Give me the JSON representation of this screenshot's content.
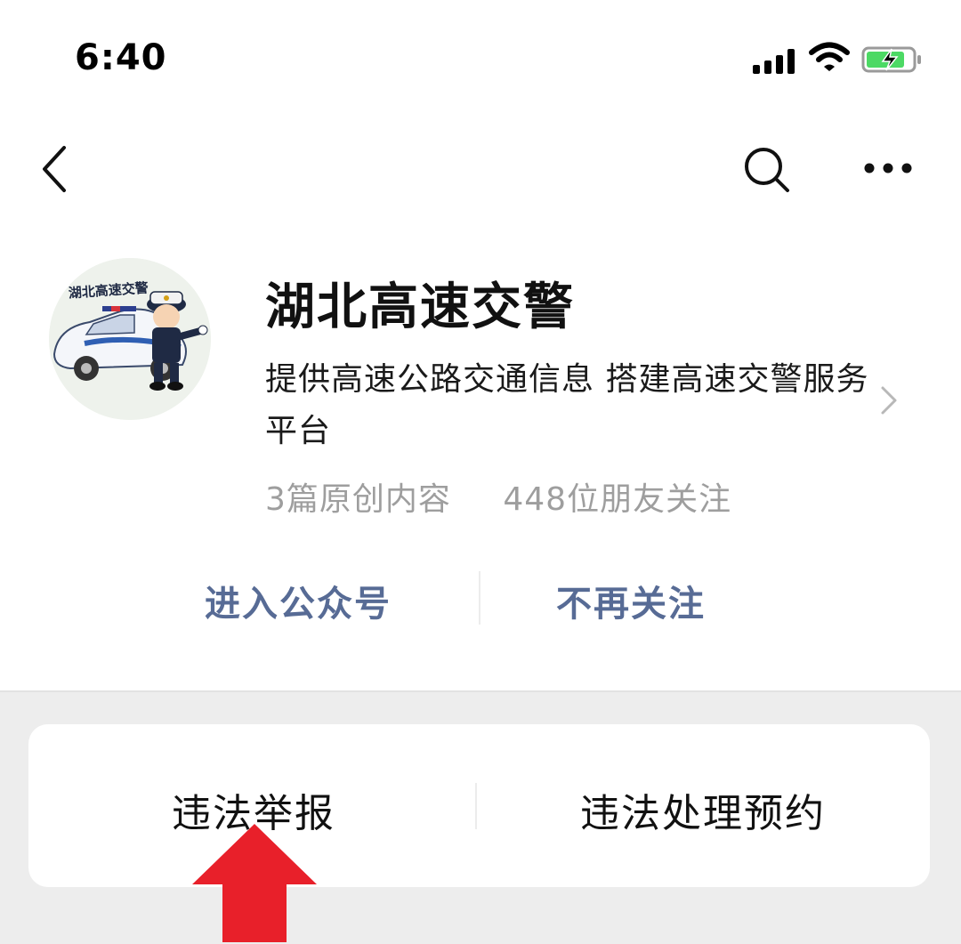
{
  "status_bar": {
    "time": "6:40",
    "battery_icon": "battery-charging-icon",
    "wifi_icon": "wifi-icon",
    "signal_icon": "cellular-signal-icon"
  },
  "nav": {
    "back_icon": "chevron-left-icon",
    "search_icon": "search-icon",
    "more_icon": "more-dots-icon"
  },
  "profile": {
    "name": "湖北高速交警",
    "description": "提供高速公路交通信息 搭建高速交警服务平台",
    "original_content": "3篇原创内容",
    "followers": "448位朋友关注",
    "avatar_lettering": "湖北高速交警"
  },
  "actions": {
    "enter": "进入公众号",
    "unfollow": "不再关注"
  },
  "menu": {
    "items": [
      "违法举报",
      "违法处理预约"
    ]
  },
  "colors": {
    "accent": "#576b95",
    "annotation_arrow": "#e8202a",
    "background_grey": "#ededed"
  }
}
